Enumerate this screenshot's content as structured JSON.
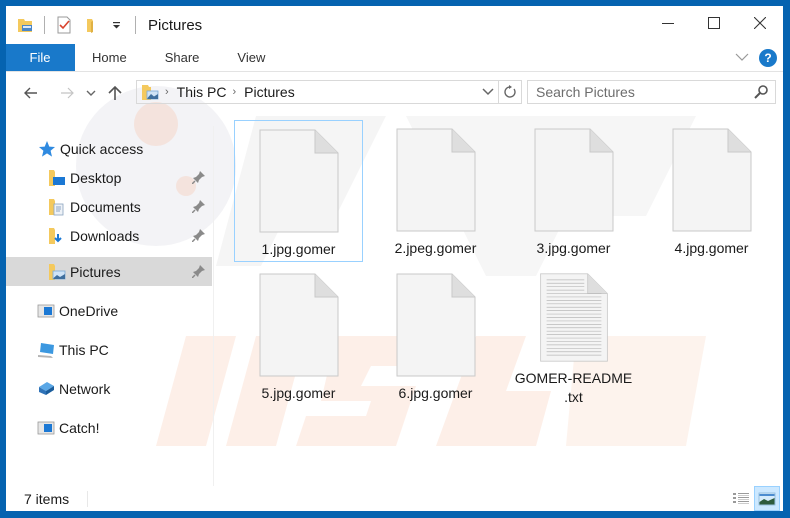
{
  "window": {
    "title": "Pictures",
    "accent_color": "#0563b0"
  },
  "quick_access_toolbar": {
    "icons": [
      "folder-properties-icon",
      "checkmark-document-icon",
      "new-folder-icon",
      "customize-dropdown-icon"
    ]
  },
  "window_controls": {
    "minimize": "minimize",
    "maximize": "maximize",
    "close": "close"
  },
  "ribbon": {
    "tabs": [
      {
        "label": "File",
        "active": true
      },
      {
        "label": "Home"
      },
      {
        "label": "Share"
      },
      {
        "label": "View"
      }
    ],
    "help_label": "?",
    "expand_icon": "chevron-down-icon"
  },
  "navigation": {
    "back": "←",
    "forward": "→",
    "recent": "⌄",
    "up": "↑",
    "breadcrumb": [
      "This PC",
      "Pictures"
    ],
    "breadcrumb_sep": "›",
    "dropdown": "⌄",
    "refresh": "↻",
    "search_placeholder": "Search Pictures"
  },
  "sidebar": {
    "quick_access": "Quick access",
    "items": [
      {
        "label": "Desktop",
        "icon": "desktop-folder-icon",
        "pinned": true
      },
      {
        "label": "Documents",
        "icon": "documents-folder-icon",
        "pinned": true
      },
      {
        "label": "Downloads",
        "icon": "downloads-folder-icon",
        "pinned": true
      },
      {
        "label": "Pictures",
        "icon": "pictures-folder-icon",
        "pinned": true,
        "selected": true
      }
    ],
    "locations": [
      {
        "label": "OneDrive",
        "icon": "onedrive-icon"
      },
      {
        "label": "This PC",
        "icon": "this-pc-icon"
      },
      {
        "label": "Network",
        "icon": "network-icon"
      },
      {
        "label": "Catch!",
        "icon": "catch-drive-icon"
      }
    ]
  },
  "files": [
    {
      "name": "1.jpg.gomer",
      "type": "blank",
      "focused": true
    },
    {
      "name": "2.jpeg.gomer",
      "type": "blank"
    },
    {
      "name": "3.jpg.gomer",
      "type": "blank"
    },
    {
      "name": "4.jpg.gomer",
      "type": "blank"
    },
    {
      "name": "5.jpg.gomer",
      "type": "blank"
    },
    {
      "name": "6.jpg.gomer",
      "type": "blank"
    },
    {
      "name": "GOMER-README\n.txt",
      "type": "text"
    }
  ],
  "status": {
    "item_count": "7 items",
    "views": [
      "details-view",
      "large-icons-view"
    ],
    "active_view": "large-icons-view"
  }
}
